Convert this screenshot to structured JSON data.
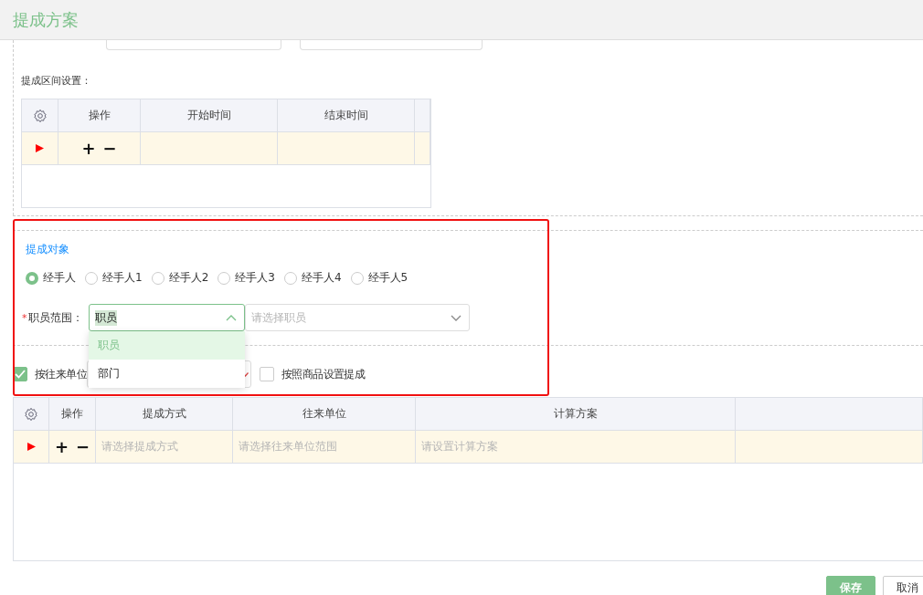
{
  "dialog": {
    "title": "提成方案"
  },
  "interval_section": {
    "label": "提成区间设置：",
    "table": {
      "columns": [
        "操作",
        "开始时间",
        "结束时间"
      ],
      "rows": [
        {
          "current": true,
          "add": "+",
          "remove": "−"
        }
      ]
    }
  },
  "target_section": {
    "title": "提成对象",
    "radios": [
      {
        "label": "经手人",
        "selected": true
      },
      {
        "label": "经手人1",
        "selected": false
      },
      {
        "label": "经手人2",
        "selected": false
      },
      {
        "label": "经手人3",
        "selected": false
      },
      {
        "label": "经手人4",
        "selected": false
      },
      {
        "label": "经手人5",
        "selected": false
      }
    ],
    "staff_range": {
      "required_mark": "*",
      "label": "职员范围：",
      "type_select": {
        "value": "职员",
        "expanded": true
      },
      "staff_select": {
        "placeholder": "请选择职员"
      }
    },
    "dropdown_options": [
      {
        "label": "职员",
        "selected": true
      },
      {
        "label": "部门",
        "selected": false
      }
    ],
    "options": [
      {
        "label": "按往来单位",
        "checked": true
      },
      {
        "label": "按照商品设置提成",
        "checked": false
      }
    ]
  },
  "rules_table": {
    "columns": [
      "操作",
      "提成方式",
      "往来单位",
      "计算方案"
    ],
    "rows": [
      {
        "current": true,
        "add": "+",
        "remove": "−",
        "placeholders": [
          "请选择提成方式",
          "请选择往来单位范围",
          "请设置计算方案"
        ]
      }
    ]
  },
  "buttons": [
    {
      "label": "保存",
      "kind": "primary"
    },
    {
      "label": "取消",
      "kind": "default"
    }
  ]
}
